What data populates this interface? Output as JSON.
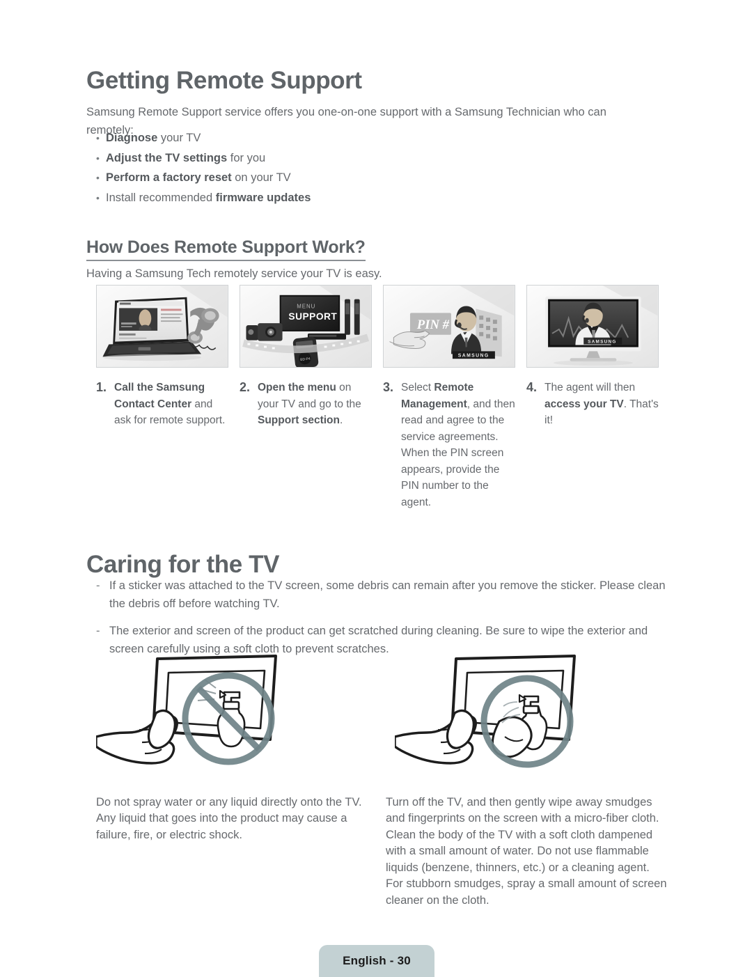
{
  "page": {
    "footer_label": "English - 30",
    "accent_color": "#c3d1d3",
    "text_color": "#66696d",
    "heading_color": "#5f6468"
  },
  "sections": {
    "remote_support": {
      "title": "Getting Remote Support",
      "intro": "Samsung Remote Support service offers you one-on-one support with a Samsung Technician who can remotely:",
      "bullets": [
        {
          "bold": "Diagnose",
          "rest": " your TV",
          "bold_first": true
        },
        {
          "bold": "Adjust the TV settings",
          "rest": " for you",
          "bold_first": true
        },
        {
          "bold": "Perform a factory reset",
          "rest": " on your TV",
          "bold_first": true
        },
        {
          "bold": "firmware updates",
          "rest": "Install recommended ",
          "bold_first": false
        }
      ],
      "subheading": "How Does Remote Support Work?",
      "lead": "Having a Samsung Tech remotely service your TV is easy.",
      "steps": [
        {
          "number": "1.",
          "bold": "Call the Samsung Contact Center",
          "rest": " and ask for remote support.",
          "bold_first": true,
          "image_name": "laptop-phone-illustration"
        },
        {
          "number": "2.",
          "bold": "Open the menu",
          "mid": " on your TV and go to the ",
          "bold2": "Support section",
          "tail": ".",
          "bold_first": true,
          "image_name": "tv-support-menu-illustration"
        },
        {
          "number": "3.",
          "lead": "Select ",
          "bold": "Remote Management",
          "rest": ", and then read and agree to the service agreements. When the PIN screen appears, provide the PIN number to the agent.",
          "bold_first": false,
          "image_name": "pin-agent-illustration"
        },
        {
          "number": "4.",
          "lead": "The agent will then ",
          "bold": "access your TV",
          "rest": ". That's it!",
          "bold_first": false,
          "image_name": "tv-agent-illustration"
        }
      ]
    },
    "caring": {
      "title": "Caring for the TV",
      "bullets": [
        "If a sticker was attached to the TV screen, some debris can remain after you remove the sticker. Please clean the debris off before watching TV.",
        "The exterior and screen of the product can get scratched during cleaning. Be sure to wipe the exterior and screen carefully using a soft cloth to prevent scratches."
      ],
      "dash": "-",
      "figures": [
        {
          "name": "no-spray-on-tv-illustration",
          "caption": "Do not spray water or any liquid directly onto the TV. Any liquid that goes into the product may cause a failure, fire, or electric shock."
        },
        {
          "name": "spray-on-cloth-illustration",
          "caption": "Turn off the TV, and then gently wipe away smudges and fingerprints on the screen with a micro-fiber cloth. Clean the body of the TV with a soft cloth dampened with a small amount of water. Do not use flammable liquids (benzene, thinners, etc.) or a cleaning agent. For stubborn smudges, spray a small amount of screen cleaner on the cloth."
        }
      ]
    }
  },
  "illustration_text": {
    "menu": "MENU",
    "support": "SUPPORT",
    "pin": "PIN #",
    "samsung": "SAMSUNG"
  }
}
